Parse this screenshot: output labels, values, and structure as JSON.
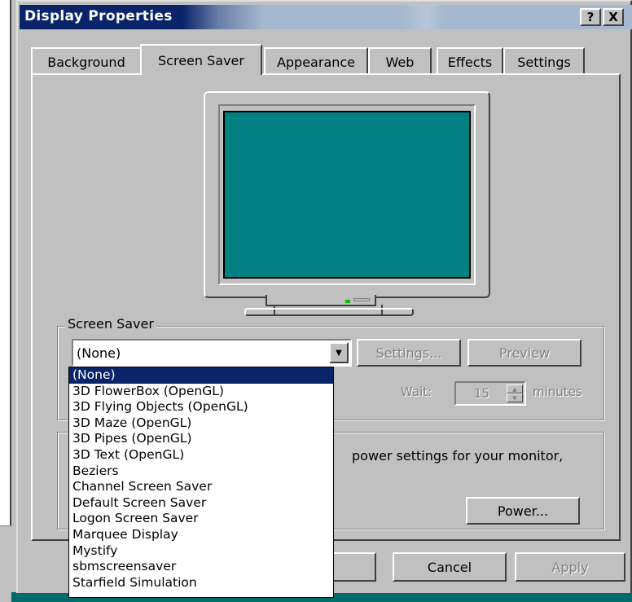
{
  "window": {
    "title": "Display Properties",
    "help_label": "?",
    "close_label": "X"
  },
  "tabs": [
    {
      "label": "Background"
    },
    {
      "label": "Screen Saver"
    },
    {
      "label": "Appearance"
    },
    {
      "label": "Web"
    },
    {
      "label": "Effects"
    },
    {
      "label": "Settings"
    }
  ],
  "screen_saver": {
    "group_label": "Screen Saver",
    "selected": "(None)",
    "settings_label": "Settings...",
    "preview_label": "Preview",
    "wait_label": "Wait:",
    "wait_value": "15",
    "minutes_label": "minutes",
    "options": [
      "(None)",
      "3D FlowerBox (OpenGL)",
      "3D Flying Objects (OpenGL)",
      "3D Maze (OpenGL)",
      "3D Pipes (OpenGL)",
      "3D Text (OpenGL)",
      "Beziers",
      "Channel Screen Saver",
      "Default Screen Saver",
      "Logon Screen Saver",
      "Marquee Display",
      "Mystify",
      "sbmscreensaver",
      "Starfield Simulation"
    ]
  },
  "energy": {
    "text": "power settings for your monitor,",
    "power_label": "Power..."
  },
  "footer": {
    "ok_label": "",
    "cancel_label": "Cancel",
    "apply_label": "Apply"
  },
  "colors": {
    "titlebar": "#0a246a",
    "screen": "#008080",
    "selection": "#0a246a"
  }
}
